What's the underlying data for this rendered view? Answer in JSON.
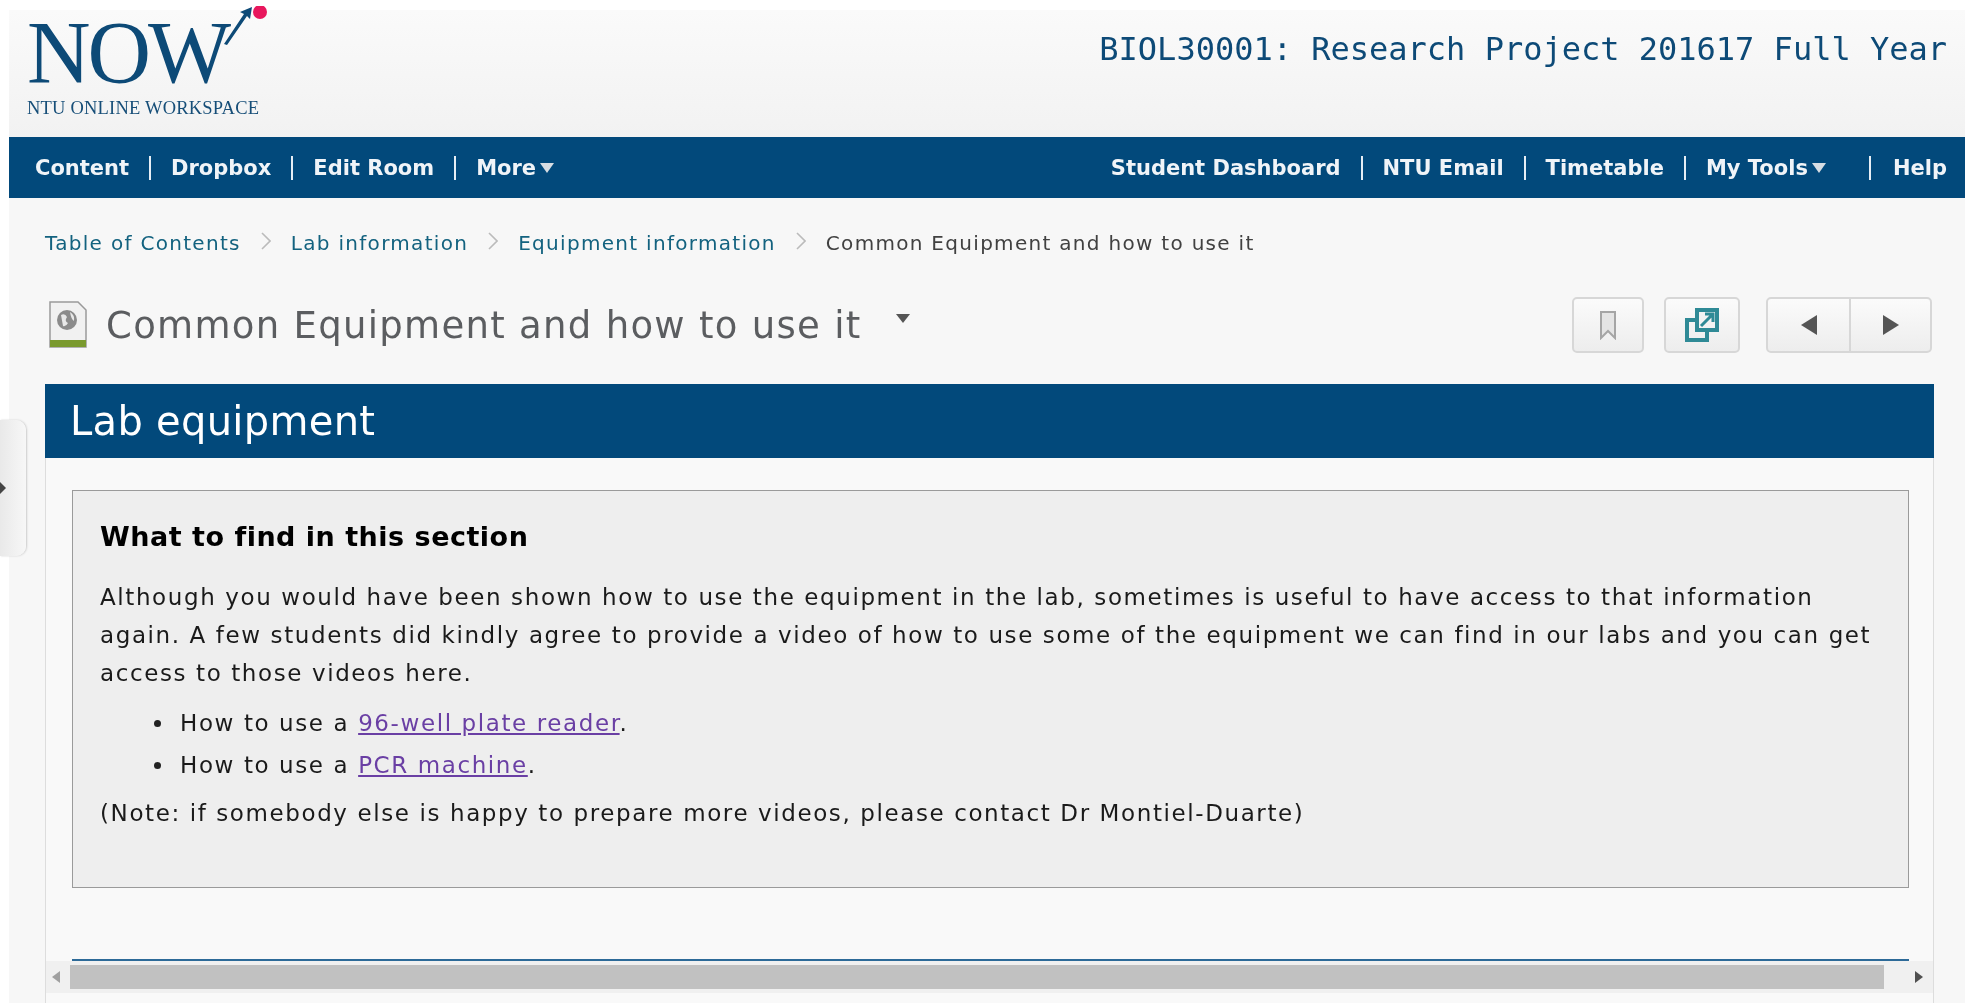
{
  "logo": {
    "wordmark": "NOW",
    "tagline": "NTU ONLINE WORKSPACE"
  },
  "course_title": "BIOL30001: Research Project 201617 Full Year",
  "nav_left": [
    {
      "label": "Content",
      "has_menu": false
    },
    {
      "label": "Dropbox",
      "has_menu": false
    },
    {
      "label": "Edit Room",
      "has_menu": false
    },
    {
      "label": "More",
      "has_menu": true
    }
  ],
  "nav_right": [
    {
      "label": "Student Dashboard",
      "has_menu": false
    },
    {
      "label": "NTU Email",
      "has_menu": false
    },
    {
      "label": "Timetable",
      "has_menu": false
    },
    {
      "label": "My Tools",
      "has_menu": true
    },
    {
      "label": "Help",
      "has_menu": false
    }
  ],
  "breadcrumbs": [
    {
      "label": "Table of Contents",
      "link": true
    },
    {
      "label": "Lab information",
      "link": true
    },
    {
      "label": "Equipment information",
      "link": true
    },
    {
      "label": "Common Equipment and how to use it",
      "link": false
    }
  ],
  "page_title": "Common Equipment and how to use it",
  "section": {
    "heading": "Lab equipment",
    "box_title": "What to find in this section",
    "intro": "Although you would have been shown how to use the equipment in the lab, sometimes is useful to have access to that information again. A few students did kindly agree to provide a video of how to use some of the equipment we can find in our labs and you can get access to those videos here.",
    "items": [
      {
        "prefix": "How to use a ",
        "link": "96-well plate reader",
        "suffix": "."
      },
      {
        "prefix": "How to use a ",
        "link": "PCR machine",
        "suffix": "."
      }
    ],
    "note": "(Note: if somebody else is happy to prepare more videos, please contact Dr Montiel-Duarte)"
  }
}
